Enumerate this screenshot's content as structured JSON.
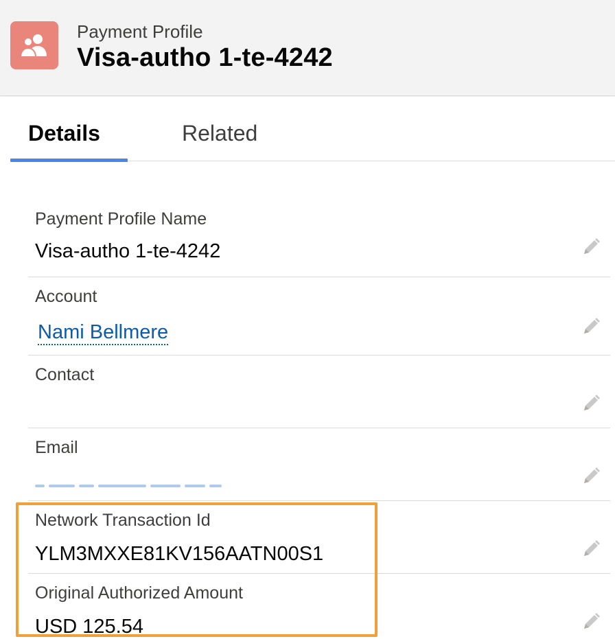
{
  "header": {
    "icon": "payment-profile-icon",
    "object_label": "Payment Profile",
    "record_title": "Visa-autho 1-te-4242"
  },
  "tabs": [
    {
      "label": "Details",
      "active": true
    },
    {
      "label": "Related",
      "active": false
    }
  ],
  "fields": {
    "payment_profile_name": {
      "label": "Payment Profile Name",
      "value": "Visa-autho 1-te-4242"
    },
    "account": {
      "label": "Account",
      "value": "Nami Bellmere"
    },
    "contact": {
      "label": "Contact",
      "value": ""
    },
    "email": {
      "label": "Email",
      "value": ""
    },
    "network_transaction_id": {
      "label": "Network Transaction Id",
      "value": "YLM3MXXE81KV156AATN00S1"
    },
    "original_authorized_amount": {
      "label": "Original Authorized Amount",
      "value": "USD 125.54"
    }
  },
  "colors": {
    "icon_bg": "#e9857a",
    "tab_accent": "#4a86e4",
    "link": "#0b5cab",
    "highlight": "#f0a03a"
  },
  "icons": {
    "edit": "pencil-icon"
  }
}
